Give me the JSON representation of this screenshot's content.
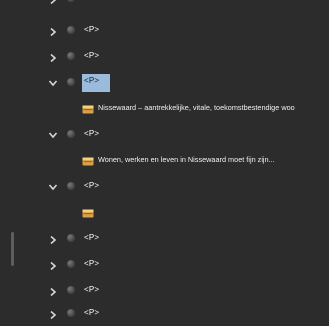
{
  "tree": {
    "tag_label": "<P>",
    "rows": [
      {
        "kind": "tag",
        "expanded": false,
        "label": "<P>"
      },
      {
        "kind": "tag",
        "expanded": false,
        "label": "<P>"
      },
      {
        "kind": "tag",
        "expanded": false,
        "label": "<P>"
      },
      {
        "kind": "tag",
        "expanded": true,
        "selected": true,
        "label": "<P>"
      },
      {
        "kind": "content",
        "text": "Nissewaard – aantrekkelijke, vitale, toekomstbestendige woo"
      },
      {
        "kind": "tag",
        "expanded": true,
        "label": "<P>"
      },
      {
        "kind": "content",
        "text": "Wonen, werken en leven in Nissewaard moet fijn zijn..."
      },
      {
        "kind": "tag",
        "expanded": true,
        "label": "<P>"
      },
      {
        "kind": "content",
        "text": ""
      },
      {
        "kind": "tag",
        "expanded": false,
        "label": "<P>"
      },
      {
        "kind": "tag",
        "expanded": false,
        "label": "<P>"
      },
      {
        "kind": "tag",
        "expanded": false,
        "label": "<P>"
      },
      {
        "kind": "tag",
        "expanded": false,
        "label": "<P>"
      }
    ]
  },
  "colors": {
    "background": "#2c2c2c",
    "selection": "#9bbbdc",
    "text": "#ffffff",
    "icon_box": "#d9a24a"
  },
  "icons": {
    "expand_collapsed": "chevron-right-icon",
    "expand_open": "chevron-down-icon",
    "visibility": "visibility-dot-icon",
    "content": "content-box-icon"
  }
}
